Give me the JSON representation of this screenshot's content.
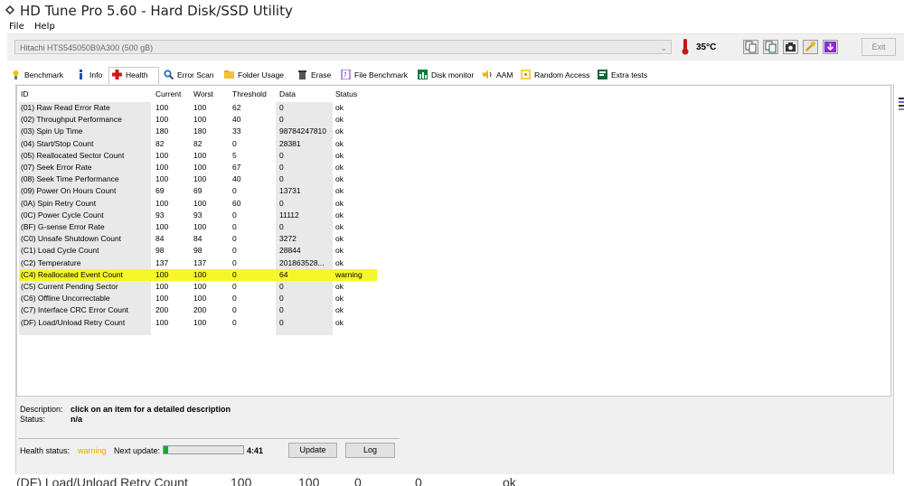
{
  "window": {
    "title": "HD Tune Pro 5.60 - Hard Disk/SSD Utility"
  },
  "menu": {
    "file": "File",
    "help": "Help"
  },
  "toolbar": {
    "drive": "Hitachi HTS545050B9A300 (500 gB)",
    "temperature": "35°C",
    "exit": "Exit"
  },
  "tabs": [
    {
      "label": "Benchmark",
      "icon": "benchmark-icon"
    },
    {
      "label": "Info",
      "icon": "info-icon"
    },
    {
      "label": "Health",
      "icon": "health-cross-icon"
    },
    {
      "label": "Error Scan",
      "icon": "magnifier-icon"
    },
    {
      "label": "Folder Usage",
      "icon": "folder-icon"
    },
    {
      "label": "Erase",
      "icon": "trash-icon"
    },
    {
      "label": "File Benchmark",
      "icon": "file-benchmark-icon"
    },
    {
      "label": "Disk monitor",
      "icon": "disk-monitor-icon"
    },
    {
      "label": "AAM",
      "icon": "speaker-icon"
    },
    {
      "label": "Random Access",
      "icon": "random-access-icon"
    },
    {
      "label": "Extra tests",
      "icon": "extra-tests-icon"
    }
  ],
  "table": {
    "headers": [
      "ID",
      "Current",
      "Worst",
      "Threshold",
      "Data",
      "Status"
    ],
    "rows": [
      [
        "(01) Raw Read Error Rate",
        "100",
        "100",
        "62",
        "0",
        "ok"
      ],
      [
        "(02) Throughput Performance",
        "100",
        "100",
        "40",
        "0",
        "ok"
      ],
      [
        "(03) Spin Up Time",
        "180",
        "180",
        "33",
        "98784247810",
        "ok"
      ],
      [
        "(04) Start/Stop Count",
        "82",
        "82",
        "0",
        "28381",
        "ok"
      ],
      [
        "(05) Reallocated Sector Count",
        "100",
        "100",
        "5",
        "0",
        "ok"
      ],
      [
        "(07) Seek Error Rate",
        "100",
        "100",
        "67",
        "0",
        "ok"
      ],
      [
        "(08) Seek Time Performance",
        "100",
        "100",
        "40",
        "0",
        "ok"
      ],
      [
        "(09) Power On Hours Count",
        "69",
        "69",
        "0",
        "13731",
        "ok"
      ],
      [
        "(0A) Spin Retry Count",
        "100",
        "100",
        "60",
        "0",
        "ok"
      ],
      [
        "(0C) Power Cycle Count",
        "93",
        "93",
        "0",
        "11112",
        "ok"
      ],
      [
        "(BF) G-sense Error Rate",
        "100",
        "100",
        "0",
        "0",
        "ok"
      ],
      [
        "(C0) Unsafe Shutdown Count",
        "84",
        "84",
        "0",
        "3272",
        "ok"
      ],
      [
        "(C1) Load Cycle Count",
        "98",
        "98",
        "0",
        "28844",
        "ok"
      ],
      [
        "(C2) Temperature",
        "137",
        "137",
        "0",
        "201863528...",
        "ok"
      ],
      [
        "(C4) Reallocated Event Count",
        "100",
        "100",
        "0",
        "64",
        "warning"
      ],
      [
        "(C5) Current Pending Sector",
        "100",
        "100",
        "0",
        "0",
        "ok"
      ],
      [
        "(C6) Offline Uncorrectable",
        "100",
        "100",
        "0",
        "0",
        "ok"
      ],
      [
        "(C7) Interface CRC Error Count",
        "200",
        "200",
        "0",
        "0",
        "ok"
      ],
      [
        "(DF) Load/Unload Retry Count",
        "100",
        "100",
        "0",
        "0",
        "ok"
      ]
    ]
  },
  "description": {
    "label": "Description:",
    "value": "click on an item for a detailed description",
    "status_label": "Status:",
    "status_value": "n/a"
  },
  "health": {
    "label": "Health status:",
    "value": "warning",
    "next_update_label": "Next update:",
    "progress": 0.06,
    "time": "4:41",
    "update_button": "Update",
    "log_button": "Log"
  },
  "background_row": [
    "(DF) Load/Unload Retry Count",
    "100",
    "100",
    "0",
    "0",
    "ok"
  ],
  "colors": {
    "warning_text": "#e0a800",
    "highlight_row": "#f6f629",
    "progress_fill": "#06b025",
    "health_cross": "#d01818"
  }
}
